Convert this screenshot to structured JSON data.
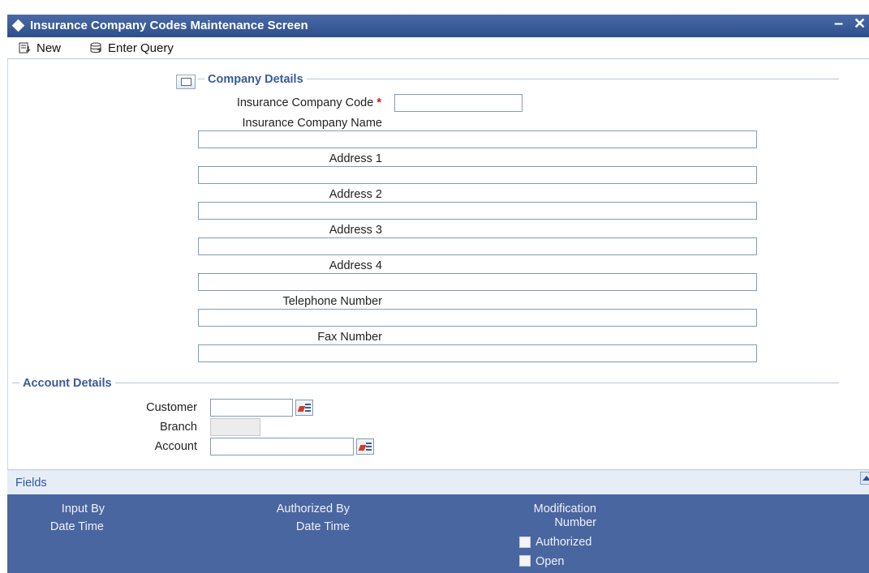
{
  "window": {
    "title": "Insurance Company Codes Maintenance Screen",
    "minimize_glyph": "–",
    "close_glyph": "✕"
  },
  "toolbar": {
    "new_label": "New",
    "enter_query_label": "Enter Query"
  },
  "company_details": {
    "section_title": "Company Details",
    "code_label": "Insurance Company Code",
    "required_mark": "*",
    "code_value": "",
    "name_label": "Insurance Company Name",
    "name_value": "",
    "address1_label": "Address 1",
    "address1_value": "",
    "address2_label": "Address 2",
    "address2_value": "",
    "address3_label": "Address 3",
    "address3_value": "",
    "address4_label": "Address 4",
    "address4_value": "",
    "telephone_label": "Telephone Number",
    "telephone_value": "",
    "fax_label": "Fax Number",
    "fax_value": ""
  },
  "account_details": {
    "section_title": "Account Details",
    "customer_label": "Customer",
    "customer_value": "",
    "branch_label": "Branch",
    "branch_value": "",
    "account_label": "Account",
    "account_value": ""
  },
  "footer": {
    "fields_label": "Fields",
    "input_by_label": "Input By",
    "input_date_time_label": "Date Time",
    "authorized_by_label": "Authorized By",
    "auth_date_time_label": "Date Time",
    "modification_label": "Modification",
    "number_label": "Number",
    "authorized_checkbox_label": "Authorized",
    "open_checkbox_label": "Open",
    "authorized_checked": false,
    "open_checked": false
  },
  "colors": {
    "title_bar": "#3a5a98",
    "section_title": "#3b5b97",
    "audit_panel": "#4a66a0",
    "fields_bar": "#e6edf6",
    "required": "#dd1111"
  }
}
